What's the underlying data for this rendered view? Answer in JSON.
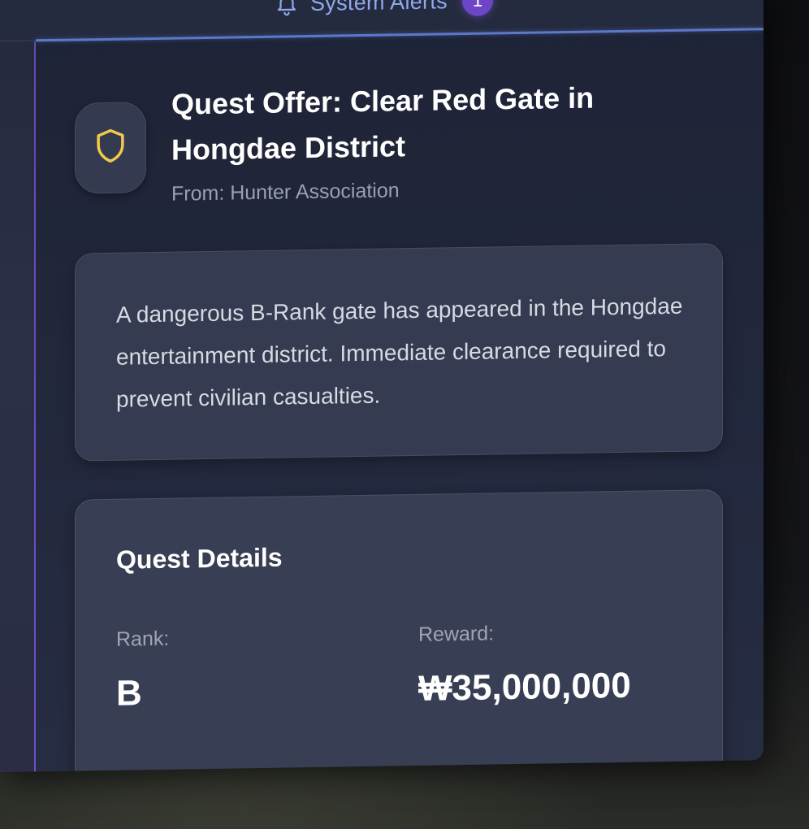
{
  "header": {
    "alerts_label": "System Alerts",
    "alerts_count": "1"
  },
  "quest": {
    "title": "Quest Offer: Clear Red Gate in Hongdae District",
    "from": "From: Hunter Association",
    "description": "A dangerous B-Rank gate has appeared in the Hongdae entertainment district. Immediate clearance required to prevent civilian casualties.",
    "icon": "shield-icon"
  },
  "details": {
    "title": "Quest Details",
    "rank_label": "Rank:",
    "rank_value": "B",
    "reward_label": "Reward:",
    "reward_value": "₩35,000,000"
  },
  "colors": {
    "accent_blue": "#8fa8ea",
    "badge_purple": "#6d45c7",
    "shield_gold": "#f2c94c"
  }
}
